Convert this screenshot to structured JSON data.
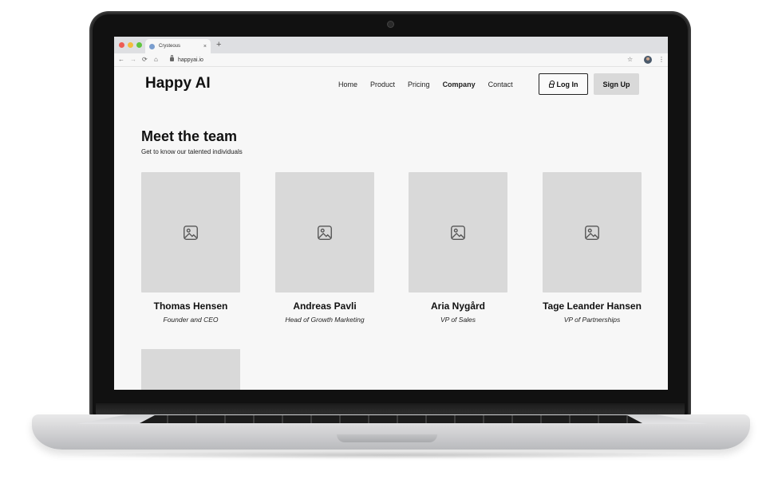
{
  "browser": {
    "tab_title": "Crysteous",
    "tab_close": "×",
    "new_tab": "+",
    "url": "happyai.io",
    "nav": {
      "back": "←",
      "forward": "→",
      "reload": "⟳",
      "home": "⌂",
      "star": "☆",
      "menu": "⋮"
    }
  },
  "site": {
    "logo": "Happy AI",
    "nav_links": [
      "Home",
      "Product",
      "Pricing",
      "Company",
      "Contact"
    ],
    "active_nav": "Company",
    "login_label": "Log In",
    "signup_label": "Sign Up"
  },
  "team": {
    "title": "Meet the team",
    "subtitle": "Get to know our talented individuals",
    "members": [
      {
        "name": "Thomas Hensen",
        "role": "Founder and CEO"
      },
      {
        "name": "Andreas Pavli",
        "role": "Head of Growth Marketing"
      },
      {
        "name": "Aria Nygård",
        "role": "VP of Sales"
      },
      {
        "name": "Tage Leander Hansen",
        "role": "VP of Partnerships"
      }
    ]
  },
  "colors": {
    "page_bg": "#f7f7f7",
    "placeholder": "#d9d9d9",
    "text": "#111111",
    "traffic_red": "#ee5b54",
    "traffic_yellow": "#f4bd3c",
    "traffic_green": "#5fc53f"
  }
}
